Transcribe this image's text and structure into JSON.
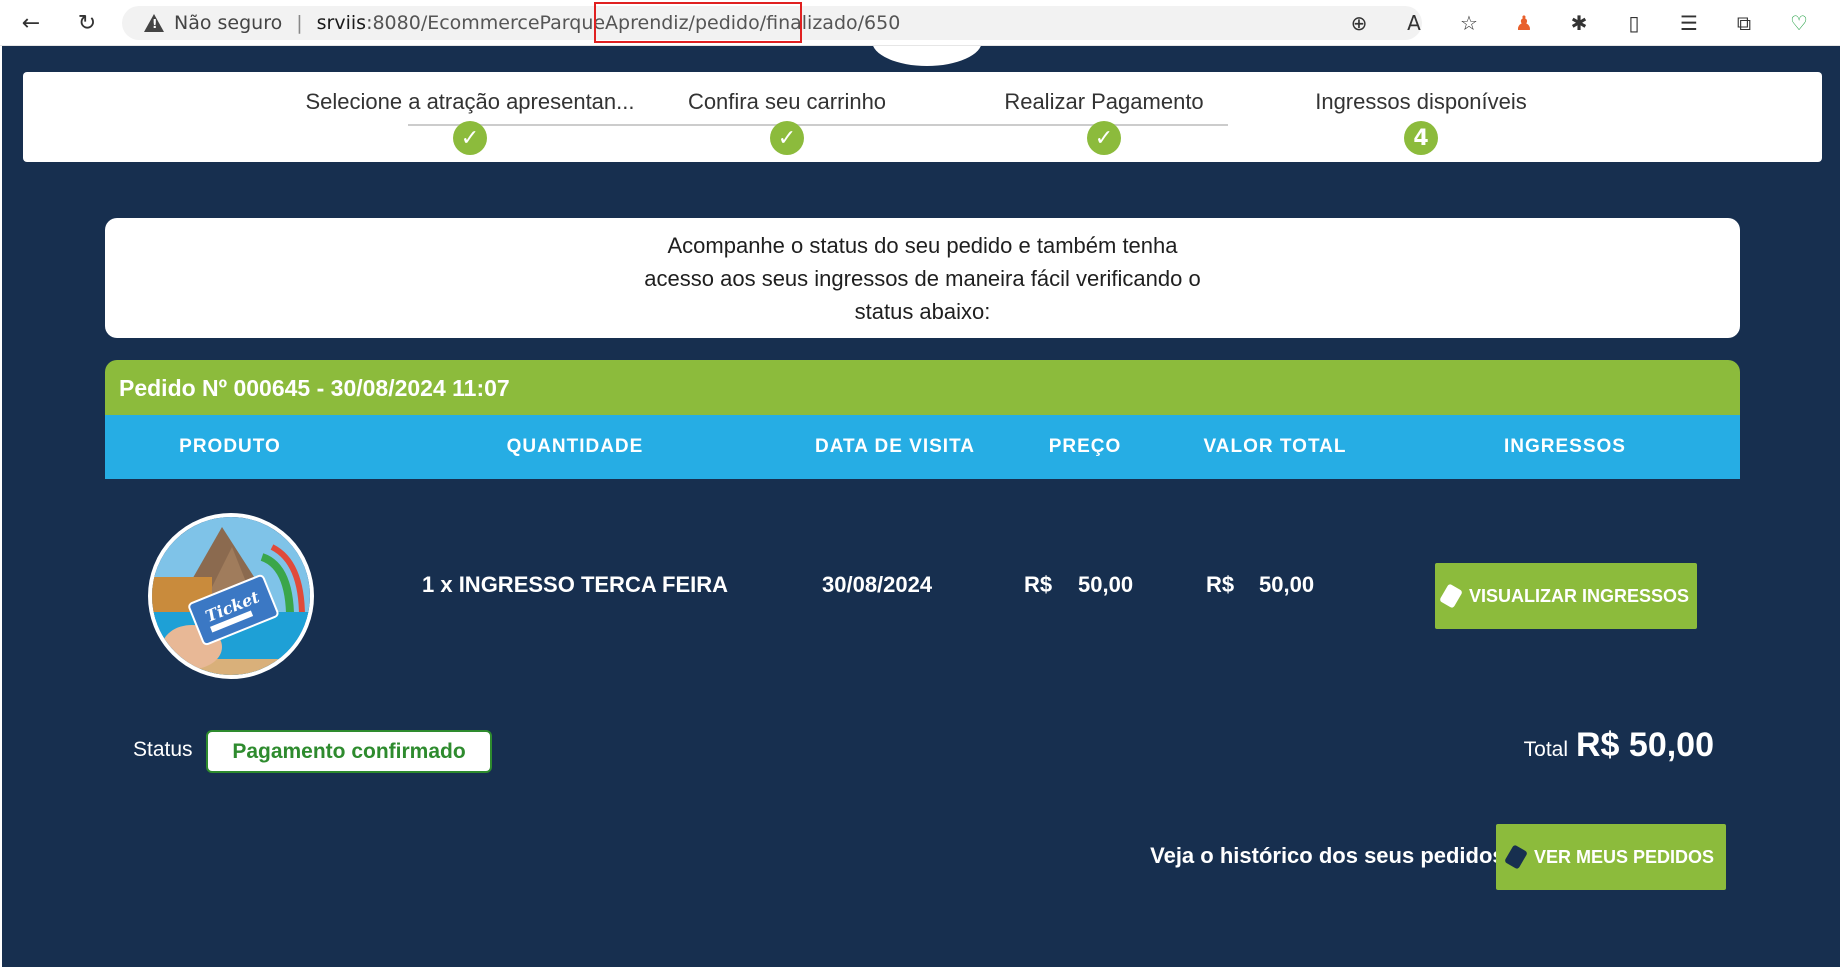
{
  "browser": {
    "security": "Não seguro",
    "url_host": "srviis",
    "url_path": ":8080/EcommerceParqueAprendiz/pedido/finalizado/650"
  },
  "stepper": {
    "steps": [
      {
        "label": "Selecione a atração apresentan...",
        "marker": "✓"
      },
      {
        "label": "Confira seu carrinho",
        "marker": "✓"
      },
      {
        "label": "Realizar Pagamento",
        "marker": "✓"
      },
      {
        "label": "Ingressos disponíveis",
        "marker": "4"
      }
    ]
  },
  "info": {
    "text": "Acompanhe o status do seu pedido e também tenha acesso aos seus ingressos de maneira fácil verificando o status abaixo:"
  },
  "order": {
    "header": "Pedido Nº 000645 - 30/08/2024 11:07",
    "columns": [
      "PRODUTO",
      "QUANTIDADE",
      "DATA DE VISITA",
      "PREÇO",
      "VALOR TOTAL",
      "INGRESSOS"
    ],
    "row": {
      "product": "1 x INGRESSO TERCA FEIRA",
      "visit_date": "30/08/2024",
      "price_currency": "R$",
      "price_value": "50,00",
      "total_currency": "R$",
      "total_value": "50,00",
      "ticket_image_text": "Ticket",
      "view_button": "VISUALIZAR INGRESSOS"
    },
    "status_label": "Status",
    "status_value": "Pagamento confirmado",
    "total_label": "Total",
    "total_value": "R$ 50,00"
  },
  "history": {
    "label": "Veja o histórico dos seus pedidos:",
    "button": "VER MEUS PEDIDOS"
  },
  "colors": {
    "page_bg": "#172f4f",
    "accent_green": "#8cbb3c",
    "table_head": "#26ade4",
    "status_green": "#2e8b2e"
  },
  "icons": [
    "back-arrow-icon",
    "refresh-icon",
    "warning-icon",
    "zoom-icon",
    "read-aloud-icon",
    "favorite-star-icon",
    "extension-icon",
    "puzzle-icon",
    "split-screen-icon",
    "favorites-icon",
    "collections-icon",
    "health-icon",
    "ticket-icon"
  ]
}
